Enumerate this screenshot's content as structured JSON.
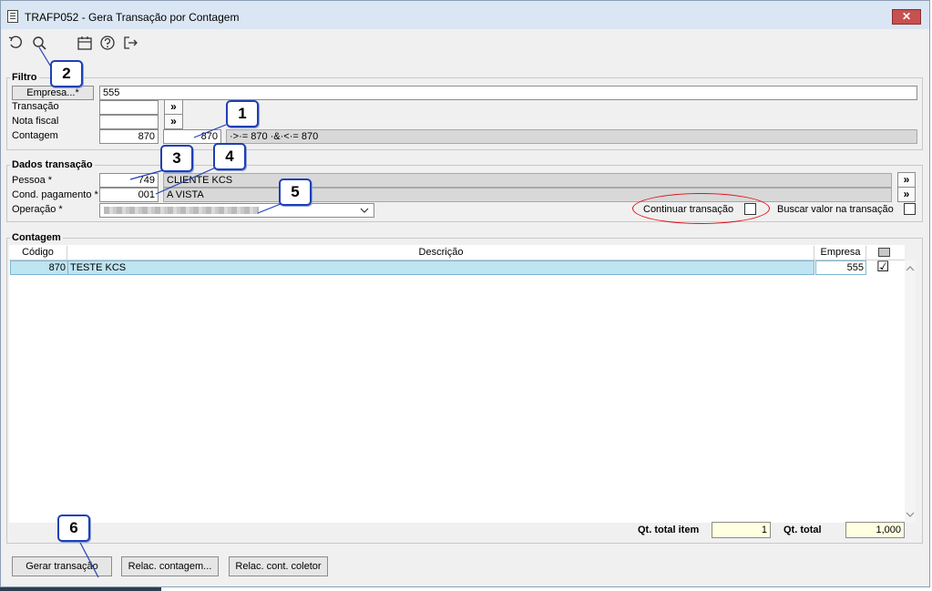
{
  "window": {
    "title": "TRAFP052 - Gera Transação por Contagem",
    "close_glyph": "✕"
  },
  "toolbar": {
    "icons": [
      "undo-icon",
      "search-icon",
      "calendar-icon",
      "help-icon",
      "exit-icon"
    ]
  },
  "filtro": {
    "label": "Filtro",
    "empresa_btn": "Empresa...*",
    "empresa_value": "555",
    "transacao_label": "Transação",
    "nota_fiscal_label": "Nota fiscal",
    "contagem_label": "Contagem",
    "contagem_from": "870",
    "contagem_to": "870",
    "contagem_expr": "·>·= 870 ·&·<·= 870",
    "more_glyph": "»"
  },
  "dados": {
    "label": "Dados transação",
    "pessoa_label": "Pessoa *",
    "pessoa_code": "749",
    "pessoa_name": "CLIENTE KCS",
    "cond_label": "Cond. pagamento *",
    "cond_code": "001",
    "cond_name": "A VISTA",
    "operacao_label": "Operação *",
    "continuar_label": "Continuar transação",
    "buscar_label": "Buscar valor na transação"
  },
  "contagem": {
    "label": "Contagem",
    "columns": [
      "Código",
      "Descrição",
      "Empresa"
    ],
    "rows": [
      {
        "codigo": "870",
        "descricao": "TESTE KCS",
        "empresa": "555",
        "checked": "☑"
      }
    ],
    "qt_total_item_label": "Qt. total item",
    "qt_total_item": "1",
    "qt_total_label": "Qt. total",
    "qt_total": "1,000"
  },
  "buttons": {
    "gerar": "Gerar transação",
    "relac_contagem": "Relac. contagem...",
    "relac_coletor": "Relac. cont. coletor"
  },
  "callouts": [
    "1",
    "2",
    "3",
    "4",
    "5",
    "6"
  ],
  "colors": {
    "callout_border": "#1f3fb5",
    "highlight_ellipse": "#e0101a",
    "selected_row": "#bfe4f2"
  }
}
